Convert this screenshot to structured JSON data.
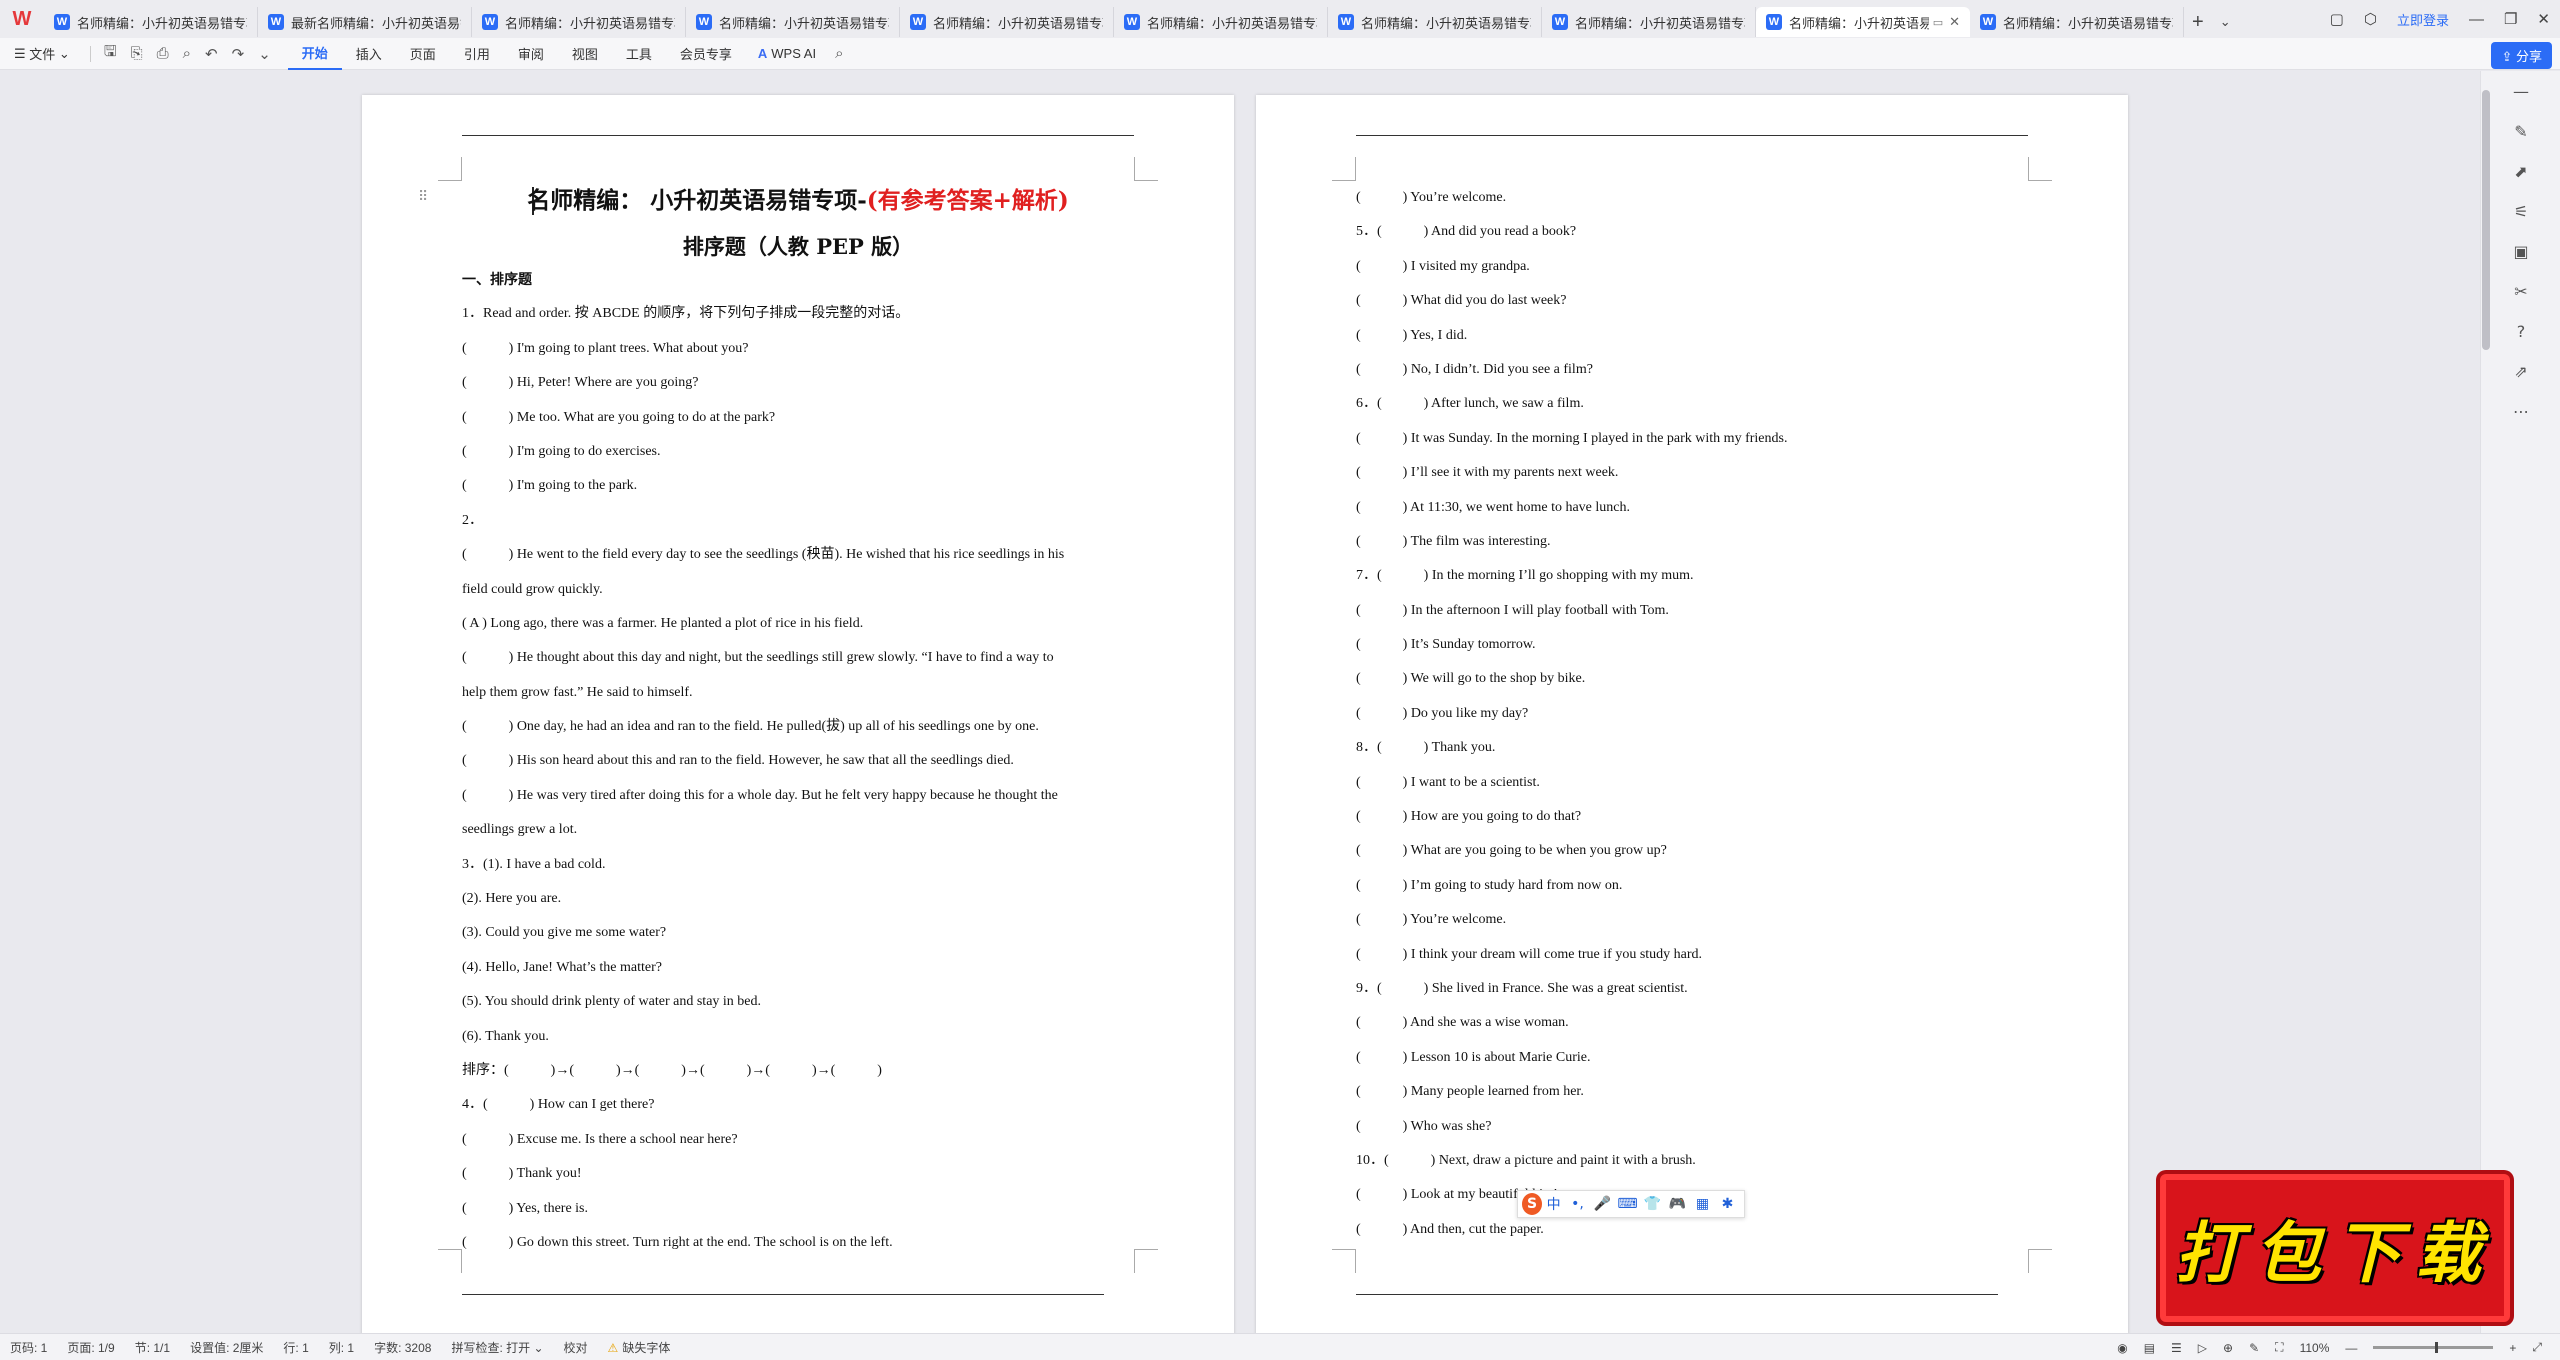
{
  "tabs": [
    {
      "label": "名师精编：小升初英语易错专项",
      "active": false
    },
    {
      "label": "最新名师精编：小升初英语易错",
      "active": false
    },
    {
      "label": "名师精编：小升初英语易错专项",
      "active": false
    },
    {
      "label": "名师精编：小升初英语易错专项",
      "active": false
    },
    {
      "label": "名师精编：小升初英语易错专项",
      "active": false
    },
    {
      "label": "名师精编：小升初英语易错专项",
      "active": false
    },
    {
      "label": "名师精编：小升初英语易错专项",
      "active": false
    },
    {
      "label": "名师精编：小升初英语易错专项",
      "active": false
    },
    {
      "label": "名师精编：小升初英语易",
      "active": true
    },
    {
      "label": "名师精编：小升初英语易错专项",
      "active": false
    }
  ],
  "titlebar": {
    "login": "立即登录",
    "share": "分享"
  },
  "menu": {
    "file": "文件",
    "items": [
      "开始",
      "插入",
      "页面",
      "引用",
      "审阅",
      "视图",
      "工具",
      "会员专享"
    ],
    "active": "开始",
    "wps_ai": "WPS AI"
  },
  "doc": {
    "title_black": "名师精编： 小升初英语易错专项-",
    "title_red": "(有参考答案+解析)",
    "subtitle": "排序题（人教 PEP 版）",
    "page1_lines": [
      {
        "t": "一、排序题",
        "h": true
      },
      {
        "t": "1．Read and order. 按 ABCDE 的顺序，将下列句子排成一段完整的对话。"
      },
      {
        "t": "(　　　) I'm going to plant trees. What about you?"
      },
      {
        "t": "(　　　) Hi, Peter! Where are you going?"
      },
      {
        "t": "(　　　) Me too. What are you going to do at the park?"
      },
      {
        "t": "(　　　) I'm going to do exercises."
      },
      {
        "t": "(　　　) I'm going to the park."
      },
      {
        "t": "2．"
      },
      {
        "t": "(　　　) He went to the field every day to see the seedlings (秧苗). He wished that his rice seedlings in his"
      },
      {
        "t": "field could grow quickly."
      },
      {
        "t": "( A ) Long ago, there was a farmer. He planted a plot of rice in his field."
      },
      {
        "t": "(　　　) He thought about this day and night, but the seedlings still grew slowly. “I have to find a way to"
      },
      {
        "t": "help them grow fast.” He said to himself."
      },
      {
        "t": "(　　　) One day, he had an idea and ran to the field. He pulled(拔) up all of his seedlings one by one."
      },
      {
        "t": "(　　　) His son heard about this and ran to the field. However, he saw that all the seedlings died."
      },
      {
        "t": "(　　　) He was very tired after doing this for a whole day. But he felt very happy because he thought the"
      },
      {
        "t": "seedlings grew a lot."
      },
      {
        "t": "3．(1). I have a bad cold."
      },
      {
        "t": "(2). Here you are."
      },
      {
        "t": "(3). Could you give me some water?"
      },
      {
        "t": "(4). Hello, Jane! What’s the matter?"
      },
      {
        "t": "(5). You should drink plenty of water and stay in bed."
      },
      {
        "t": "(6). Thank you."
      },
      {
        "t": "排序：(　　　)→(　　　)→(　　　)→(　　　)→(　　　)→(　　　)"
      },
      {
        "t": "4．(　　　) How can I get there?"
      },
      {
        "t": "(　　　) Excuse me. Is there a school near here?"
      },
      {
        "t": "(　　　) Thank you!"
      },
      {
        "t": "(　　　) Yes, there is."
      },
      {
        "t": "(　　　) Go down this street. Turn right at the end. The school is on the left."
      }
    ],
    "page2_lines": [
      {
        "t": "(　　　) You’re welcome."
      },
      {
        "t": "5．(　　　) And did you read a book?"
      },
      {
        "t": "(　　　) I visited my grandpa."
      },
      {
        "t": "(　　　) What did you do last week?"
      },
      {
        "t": "(　　　) Yes, I did."
      },
      {
        "t": "(　　　) No, I didn’t. Did you see a film?"
      },
      {
        "t": "6．(　　　) After lunch, we saw a film."
      },
      {
        "t": "(　　　) It was Sunday. In the morning I played in the park with my friends."
      },
      {
        "t": "(　　　) I’ll see it with my parents next week."
      },
      {
        "t": "(　　　) At 11:30, we went home to have lunch."
      },
      {
        "t": "(　　　) The film was interesting."
      },
      {
        "t": "7．(　　　) In the morning I’ll go shopping with my mum."
      },
      {
        "t": "(　　　) In the afternoon I will play football with Tom."
      },
      {
        "t": "(　　　) It’s Sunday tomorrow."
      },
      {
        "t": "(　　　) We will go to the shop by bike."
      },
      {
        "t": "(　　　) Do you like my day?"
      },
      {
        "t": "8．(　　　) Thank you."
      },
      {
        "t": "(　　　) I want to be a scientist."
      },
      {
        "t": "(　　　) How are you going to do that?"
      },
      {
        "t": "(　　　) What are you going to be when you grow up?"
      },
      {
        "t": "(　　　) I’m going to study hard from now on."
      },
      {
        "t": "(　　　) You’re welcome."
      },
      {
        "t": "(　　　) I think your dream will come true if you study hard."
      },
      {
        "t": "9．(　　　) She lived in France. She was a great scientist."
      },
      {
        "t": "(　　　) And she was a wise woman."
      },
      {
        "t": "(　　　) Lesson 10 is about Marie Curie."
      },
      {
        "t": "(　　　) Many people learned from her."
      },
      {
        "t": "(　　　) Who was she?"
      },
      {
        "t": "10．(　　　) Next, draw a picture and paint it with a brush."
      },
      {
        "t": "(　　　) Look at my beautiful kite!"
      },
      {
        "t": "(　　　) And then, cut the paper."
      }
    ]
  },
  "ime": {
    "logo": "S",
    "mode": "中",
    "items": [
      "•,",
      "🎤",
      "⌨",
      "👕",
      "🎮",
      "▦",
      "✱"
    ]
  },
  "status": {
    "page": "页码: 1",
    "pages": "页面: 1/9",
    "section": "节: 1/1",
    "setting": "设置值: 2厘米",
    "row": "行: 1",
    "col": "列: 1",
    "words": "字数: 3208",
    "spell": "拼写检查: 打开 ⌄",
    "proof": "校对",
    "font_missing": "缺失字体",
    "zoom": "110%"
  },
  "badge": {
    "text": "打包下载"
  }
}
